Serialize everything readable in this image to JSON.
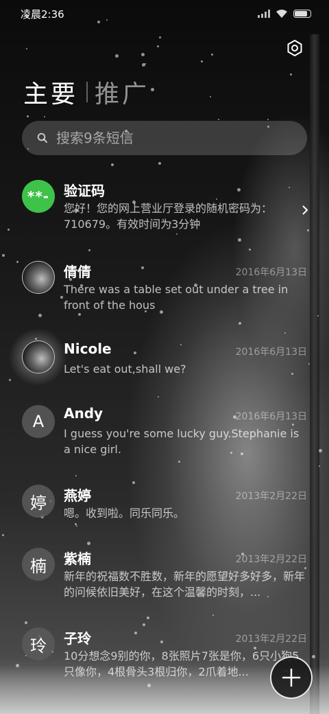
{
  "status_bar": {
    "time": "凌晨2:36"
  },
  "tabs": {
    "primary": "主要",
    "secondary": "推广"
  },
  "search": {
    "placeholder": "搜索9条短信"
  },
  "conversations": [
    {
      "avatar_text": "**-",
      "name": "验证码",
      "date": "",
      "preview": "您好！您的网上营业厅登录的随机密码为：710679。有效时间为3分钟"
    },
    {
      "avatar_text": "",
      "name": "倩倩",
      "date": "2016年6月13日",
      "preview": "There was a table set out under a tree in front of the hous"
    },
    {
      "avatar_text": "",
      "name": "Nicole",
      "date": "2016年6月13日",
      "preview": "Let's eat out,shall we?"
    },
    {
      "avatar_text": "A",
      "name": "Andy",
      "date": "2016年6月13日",
      "preview": "I guess you're some lucky guy.Stephanie is a nice girl."
    },
    {
      "avatar_text": "婷",
      "name": "燕婷",
      "date": "2013年2月22日",
      "preview": "嗯。收到啦。同乐同乐。"
    },
    {
      "avatar_text": "楠",
      "name": "紫楠",
      "date": "2013年2月22日",
      "preview": "新年的祝福数不胜数，新年的愿望好多好多，新年的问候依旧美好，在这个温馨的时刻，..."
    },
    {
      "avatar_text": "玲",
      "name": "子玲",
      "date": "2013年2月22日",
      "preview": "10分想念9别的你，8张照片7张是你，6只小狗5只像你，4根骨头3根归你，2爪着地..."
    }
  ],
  "icons": {
    "settings": "gear-icon",
    "search": "search-icon",
    "chevron": "chevron-right-icon",
    "compose": "plus-icon",
    "wifi": "wifi-icon",
    "signal": "signal-icon",
    "battery": "battery-icon"
  },
  "colors": {
    "verification_avatar": "#3fc24a"
  }
}
